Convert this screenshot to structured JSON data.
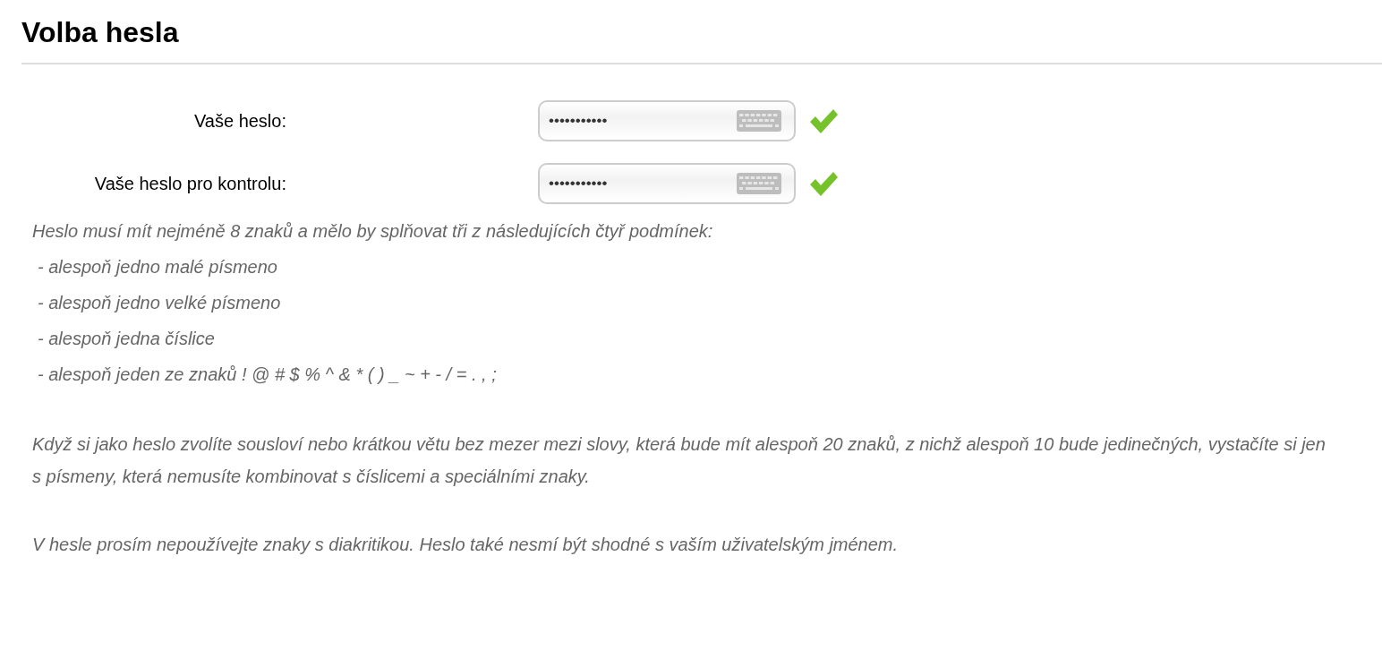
{
  "title": "Volba hesla",
  "fields": [
    {
      "label": "Vaše heslo:",
      "value": "•••••••••••",
      "valid": true
    },
    {
      "label": "Vaše heslo pro kontrolu:",
      "value": "•••••••••••",
      "valid": true
    }
  ],
  "rules_intro": "Heslo musí mít nejméně 8 znaků a mělo by splňovat tři z následujících čtyř podmínek:",
  "rules": [
    "- alespoň jedno malé písmeno",
    "- alespoň jedno velké písmeno",
    "- alespoň jedna číslice",
    "- alespoň jeden ze znaků ! @ # $ % ^ & * ( ) _ ~ + - / = . , ;"
  ],
  "notes": [
    "Když si jako heslo zvolíte sousloví nebo krátkou větu bez mezer mezi slovy, která bude mít alespoň 20 znaků, z nichž alespoň 10 bude jedinečných, vystačíte si jen s písmeny, která nemusíte kombinovat s číslicemi a speciálními znaky.",
    "V hesle prosím nepoužívejte znaky s diakritikou. Heslo také nesmí být shodné s vaším uživatelským jménem."
  ]
}
